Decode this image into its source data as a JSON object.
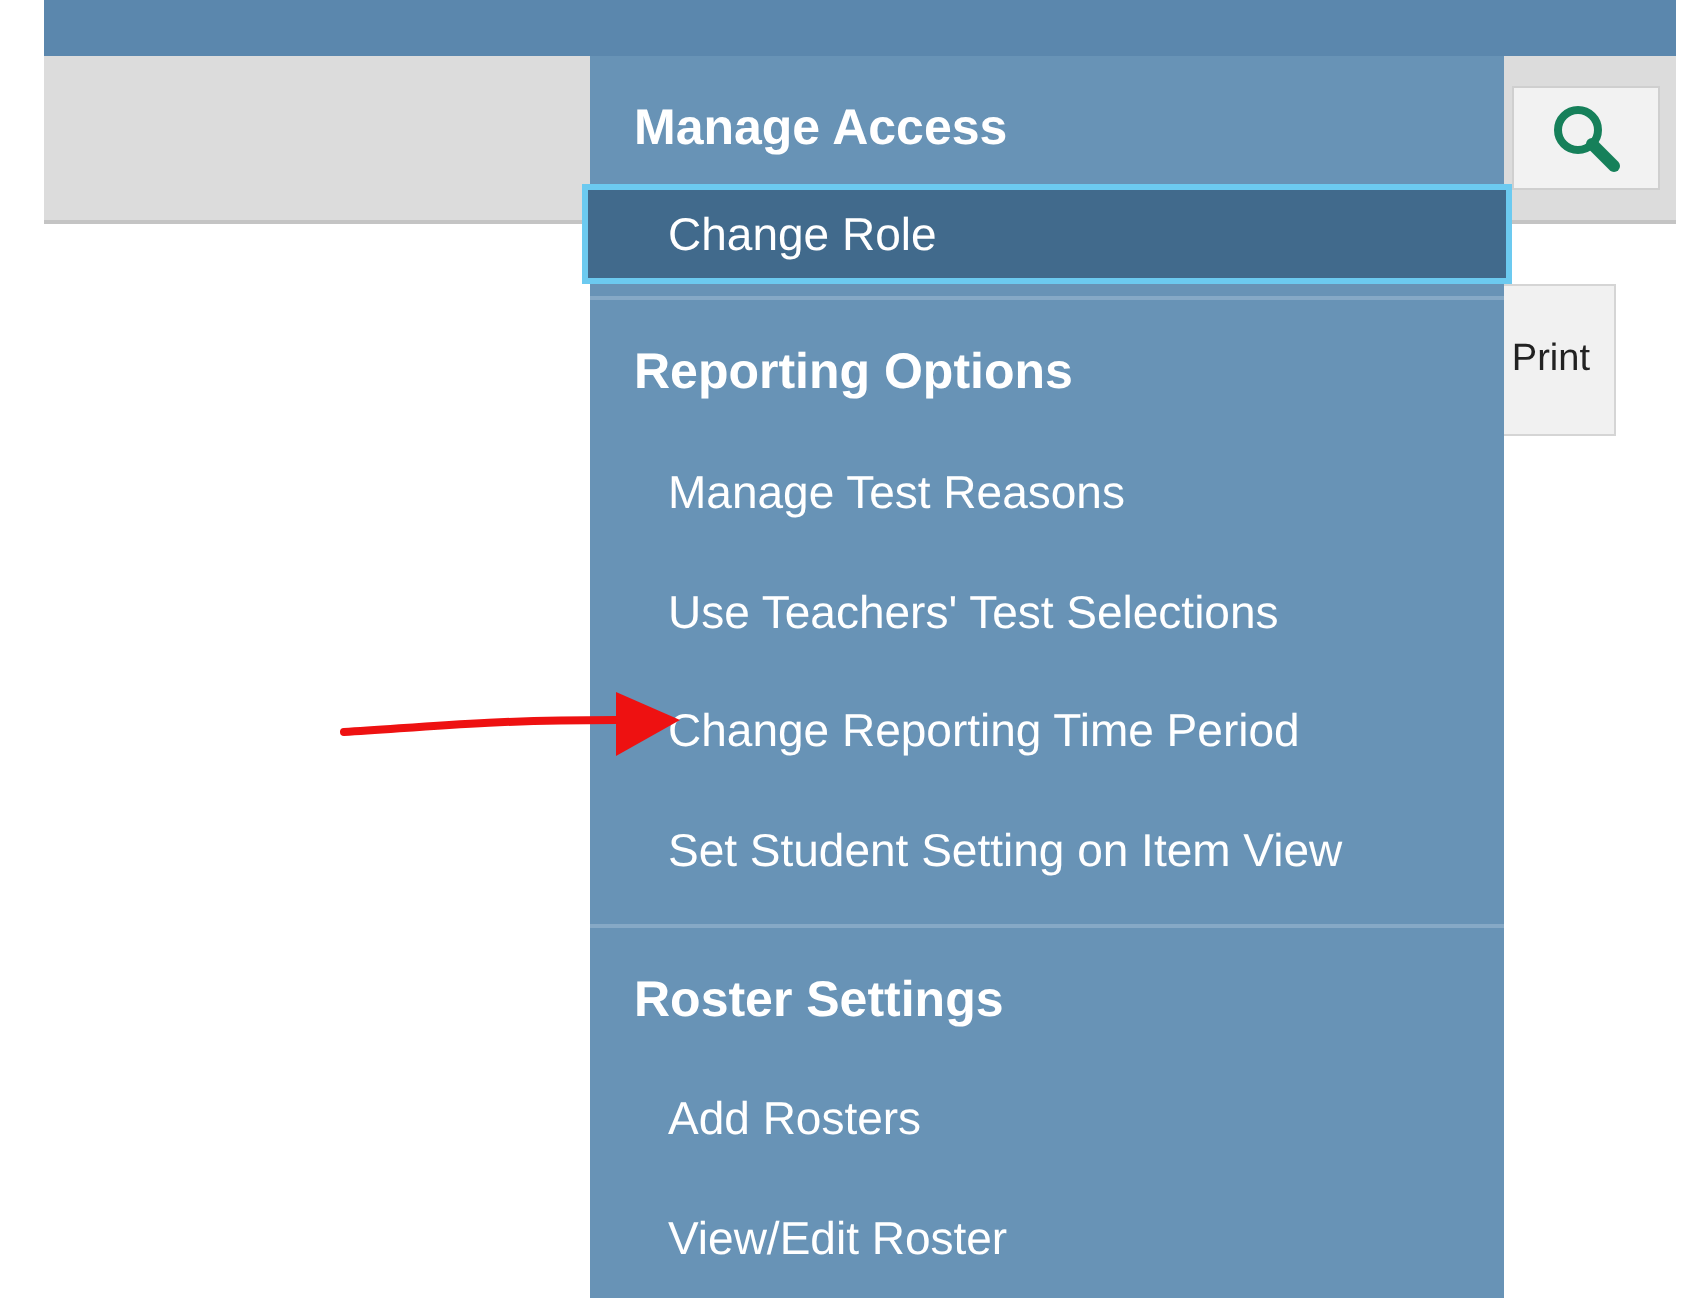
{
  "print_button": {
    "label": "Print"
  },
  "menu": {
    "sections": [
      {
        "title": "Manage Access",
        "items": [
          {
            "label": "Change Role",
            "selected": true
          }
        ]
      },
      {
        "title": "Reporting Options",
        "items": [
          {
            "label": "Manage Test Reasons",
            "selected": false
          },
          {
            "label": "Use Teachers' Test Selections",
            "selected": false
          },
          {
            "label": "Change Reporting Time Period",
            "selected": false
          },
          {
            "label": "Set Student Setting on Item View",
            "selected": false
          }
        ]
      },
      {
        "title": "Roster Settings",
        "items": [
          {
            "label": "Add Rosters",
            "selected": false
          },
          {
            "label": "View/Edit Roster",
            "selected": false
          }
        ]
      }
    ]
  }
}
